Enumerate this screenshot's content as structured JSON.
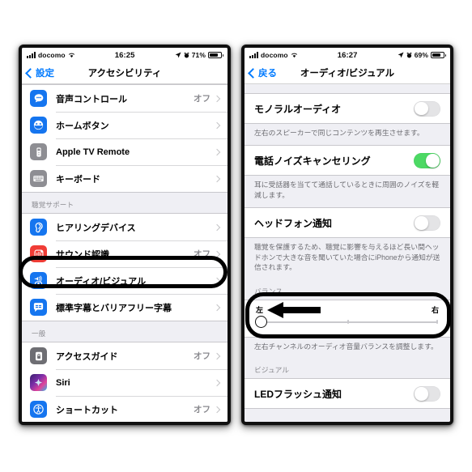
{
  "left_phone": {
    "status_bar": {
      "carrier": "docomo",
      "time": "16:25",
      "battery_pct": "71%",
      "signal_icon": "signal-bars-icon",
      "wifi_icon": "wifi-icon",
      "location_icon": "location-arrow-icon",
      "alarm_icon": "alarm-clock-icon",
      "battery_icon": "battery-icon"
    },
    "nav": {
      "back_label": "設定",
      "title": "アクセシビリティ"
    },
    "rows_top": [
      {
        "label": "音声コントロール",
        "value": "オフ",
        "icon": "voice-control-icon",
        "icon_color": "#1575ef"
      },
      {
        "label": "ホームボタン",
        "value": "",
        "icon": "home-button-icon",
        "icon_color": "#1575ef"
      },
      {
        "label": "Apple TV Remote",
        "value": "",
        "icon": "apple-tv-remote-icon",
        "icon_color": "#8e8e93"
      },
      {
        "label": "キーボード",
        "value": "",
        "icon": "keyboard-icon",
        "icon_color": "#8e8e93"
      }
    ],
    "group_hearing_label": "聴覚サポート",
    "rows_hearing": [
      {
        "label": "ヒアリングデバイス",
        "value": "",
        "icon": "ear-icon",
        "icon_color": "#1575ef"
      },
      {
        "label": "サウンド認識",
        "value": "オフ",
        "icon": "sound-recognition-icon",
        "icon_color": "#f03d36"
      },
      {
        "label": "オーディオ/ビジュアル",
        "value": "",
        "icon": "audio-visual-icon",
        "icon_color": "#1575ef"
      },
      {
        "label": "標準字幕とバリアフリー字幕",
        "value": "",
        "icon": "subtitles-icon",
        "icon_color": "#1575ef"
      }
    ],
    "group_general_label": "一般",
    "rows_general": [
      {
        "label": "アクセスガイド",
        "value": "オフ",
        "icon": "guided-access-icon",
        "icon_color": "#6e6e73"
      },
      {
        "label": "Siri",
        "value": "",
        "icon": "siri-icon",
        "icon_color": "#2b1a4d"
      },
      {
        "label": "ショートカット",
        "value": "オフ",
        "icon": "accessibility-shortcut-icon",
        "icon_color": "#1575ef"
      }
    ]
  },
  "right_phone": {
    "status_bar": {
      "carrier": "docomo",
      "time": "16:27",
      "battery_pct": "69%"
    },
    "nav": {
      "back_label": "戻る",
      "title": "オーディオ/ビジュアル"
    },
    "mono_audio": {
      "label": "モノラルオーディオ",
      "state": "off",
      "footnote": "左右のスピーカーで同じコンテンツを再生させます。"
    },
    "noise_cancel": {
      "label": "電話ノイズキャンセリング",
      "state": "on",
      "footnote": "耳に受話器を当てて通話しているときに周囲のノイズを軽減します。"
    },
    "headphone_notify": {
      "label": "ヘッドフォン通知",
      "state": "off",
      "footnote": "聴覚を保護するため、聴覚に影響を与えるほど長い間ヘッドホンで大きな音を聞いていた場合にiPhoneから通知が送信されます。"
    },
    "balance": {
      "section_label": "バランス",
      "left_label": "左",
      "right_label": "右",
      "value": 0,
      "min": 0,
      "max": 100,
      "footnote": "左右チャンネルのオーディオ音量バランスを調整します。"
    },
    "visual": {
      "section_label": "ビジュアル",
      "led_flash": {
        "label": "LEDフラッシュ通知",
        "state": "off"
      }
    }
  },
  "annotations": {
    "highlight_audio_visual": "black-oval-highlight",
    "highlight_balance": "black-oval-highlight",
    "arrow_left": "black-left-arrow"
  },
  "colors": {
    "accent_blue": "#007aff",
    "toggle_green": "#4cd964",
    "group_bg": "#efeff4",
    "annotation": "#000000"
  }
}
